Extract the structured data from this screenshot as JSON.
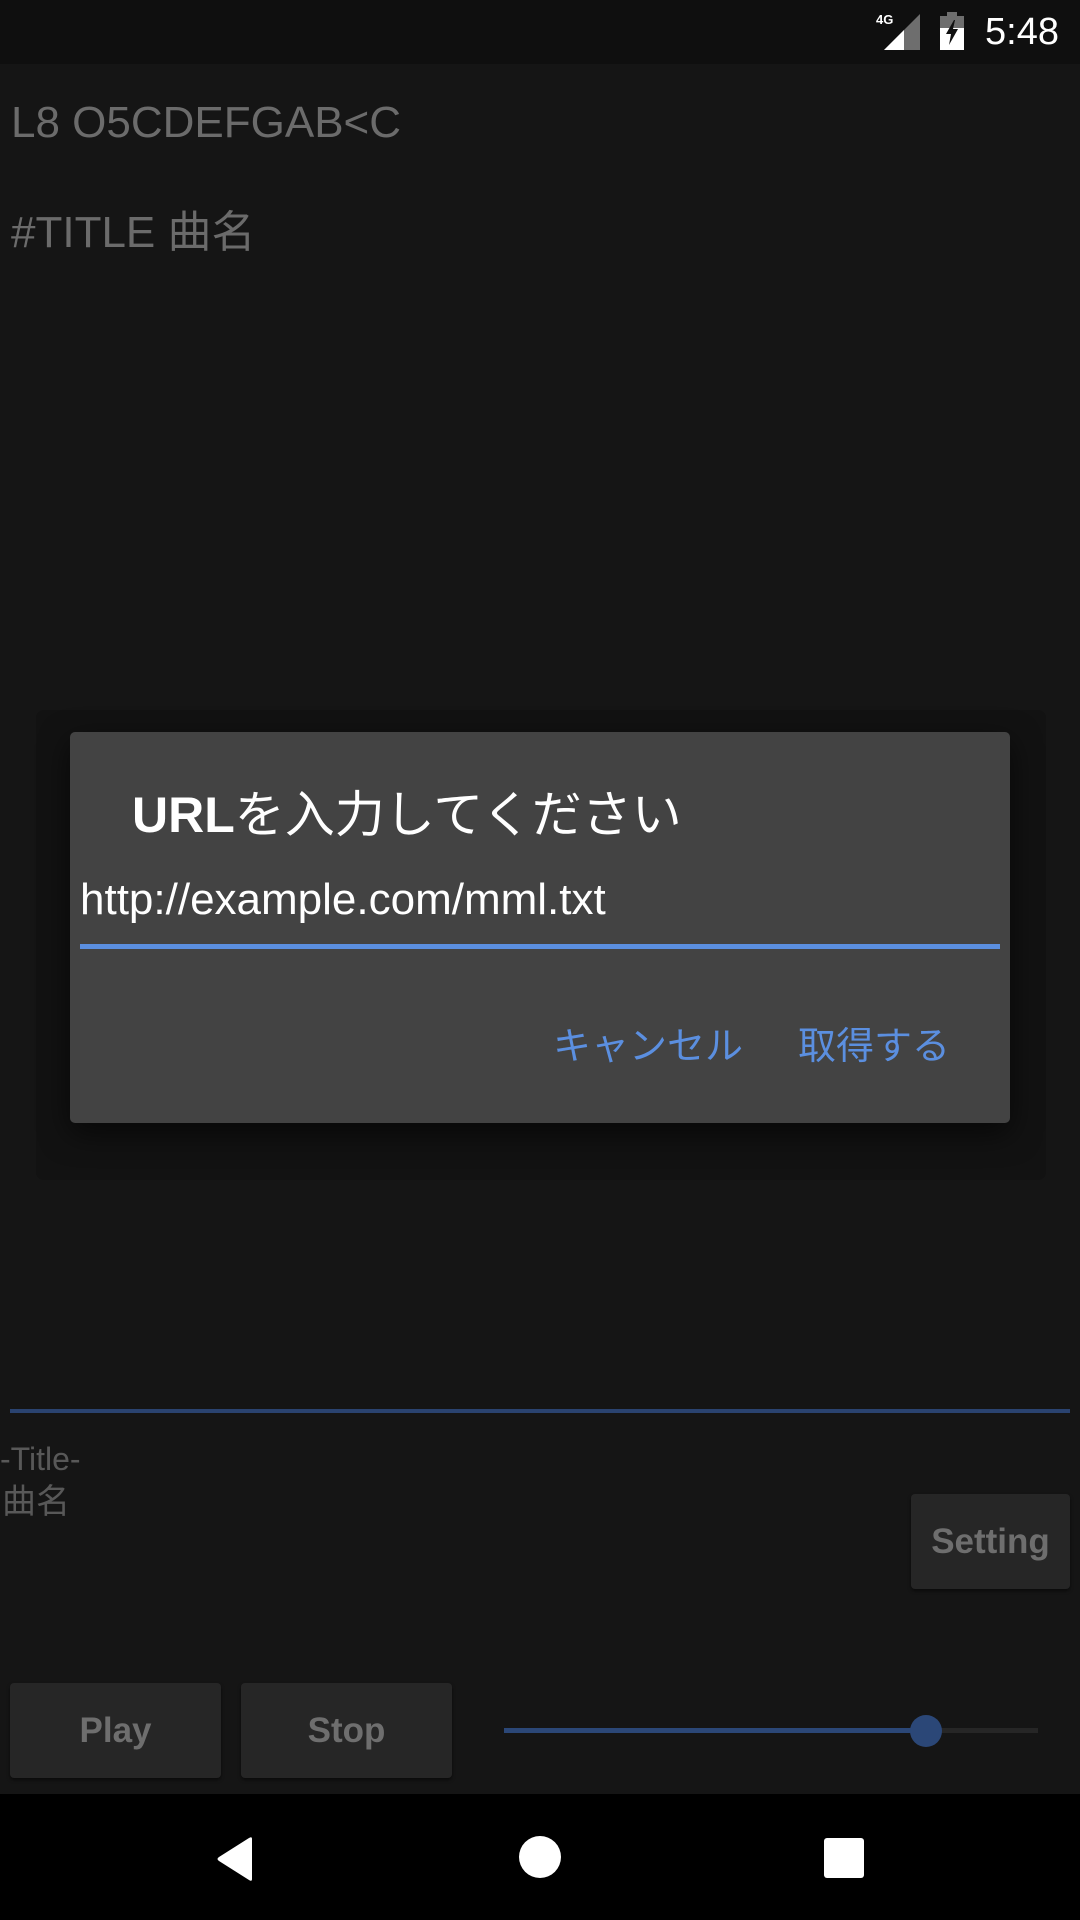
{
  "status_bar": {
    "network": "4G",
    "time": "5:48",
    "icons": [
      "signal-4g-icon",
      "battery-charging-icon"
    ]
  },
  "editor": {
    "lines": [
      "L8 O5CDEFGAB<C",
      "#TITLE 曲名"
    ]
  },
  "song_info": {
    "title_label": "-Title-",
    "title_value": "曲名"
  },
  "buttons": {
    "setting": "Setting",
    "play": "Play",
    "stop": "Stop"
  },
  "slider": {
    "value_percent": 79
  },
  "colors": {
    "accent": "#5b8fe0",
    "accent_dimmed": "#2b4777",
    "background": "#151515",
    "dialog_background": "#434343"
  },
  "dialog": {
    "title_prefix": "URL",
    "title_suffix": "を入力してください",
    "input_value": "http://example.com/mml.txt",
    "cancel_label": "キャンセル",
    "ok_label": "取得する"
  },
  "nav_bar": {
    "icons": [
      "back-icon",
      "home-icon",
      "recents-icon"
    ]
  }
}
